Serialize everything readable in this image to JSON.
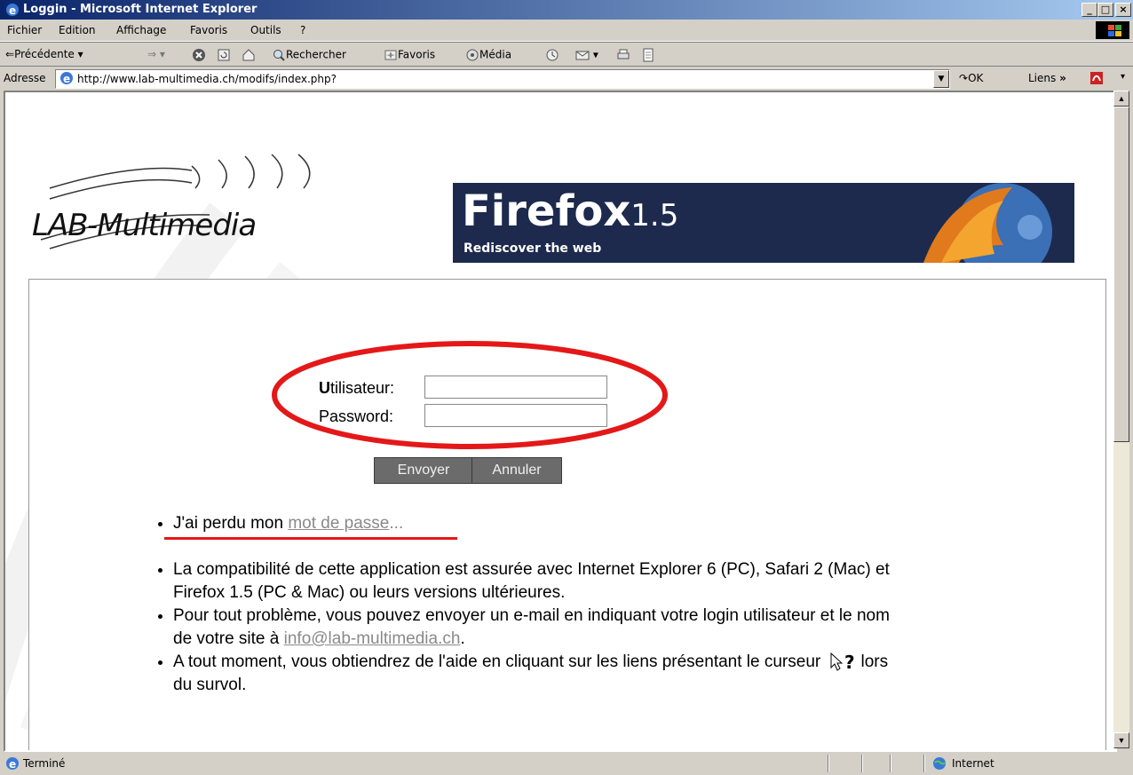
{
  "window": {
    "title": "Loggin - Microsoft Internet Explorer"
  },
  "menu": [
    "Fichier",
    "Edition",
    "Affichage",
    "Favoris",
    "Outils",
    "?"
  ],
  "toolbar": {
    "back": "Précédente",
    "search": "Rechercher",
    "favorites": "Favoris",
    "media": "Média"
  },
  "address": {
    "label": "Adresse",
    "url": "http://www.lab-multimedia.ch/modifs/index.php?",
    "go": "OK",
    "links": "Liens"
  },
  "page": {
    "logo": "LAB-Multimedia",
    "banner": {
      "product": "Firefox",
      "version": "1.5",
      "tagline": "Rediscover the web"
    },
    "form": {
      "user_label_first": "U",
      "user_label_rest": "tilisateur:",
      "password_label": "Password:",
      "user_value": "",
      "password_value": "",
      "submit": "Envoyer",
      "cancel": "Annuler"
    },
    "lost_password": {
      "prefix": "J'ai perdu mon ",
      "link": "mot de passe",
      "suffix": "..."
    },
    "notes": {
      "compat": "La compatibilité de cette application est assurée avec Internet Explorer 6 (PC), Safari 2 (Mac) et Firefox 1.5 (PC & Mac) ou leurs versions ultérieures.",
      "problem_prefix": "Pour tout problème, vous pouvez envoyer un e-mail en indiquant votre login utilisateur et le nom de votre site à ",
      "problem_email": "info@lab-multimedia.ch",
      "problem_suffix": ".",
      "help_prefix": "A tout moment, vous obtiendrez de l'aide en cliquant sur les liens présentant le curseur",
      "help_suffix": "lors du survol."
    }
  },
  "status": {
    "text": "Terminé",
    "zone": "Internet"
  }
}
